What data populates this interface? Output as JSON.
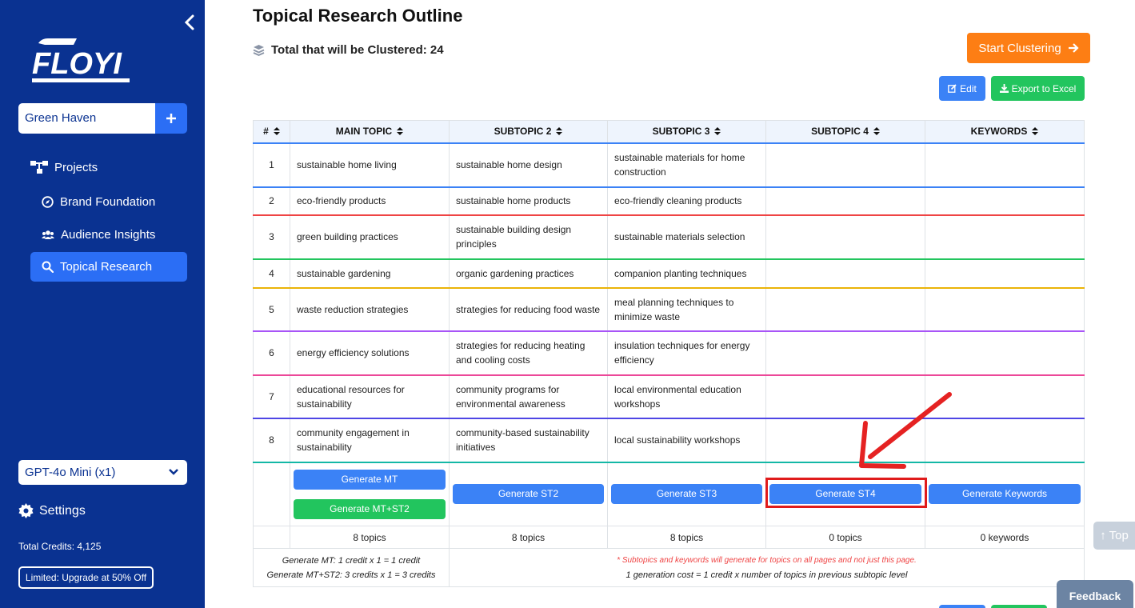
{
  "sidebar": {
    "project_name": "Green Haven",
    "logo_text": "FLOYI",
    "nav": {
      "projects": "Projects",
      "brand_foundation": "Brand Foundation",
      "audience_insights": "Audience Insights",
      "topical_research": "Topical Research"
    },
    "model": "GPT-4o Mini (x1)",
    "settings": "Settings",
    "credits": "Total Credits: 4,125",
    "upgrade": "Limited: Upgrade at 50% Off"
  },
  "header": {
    "title": "Topical Research Outline",
    "total": "Total that will be Clustered: 24",
    "start": "Start Clustering",
    "edit": "Edit",
    "export": "Export to Excel"
  },
  "table": {
    "columns": [
      "#",
      "MAIN TOPIC",
      "SUBTOPIC 2",
      "SUBTOPIC 3",
      "SUBTOPIC 4",
      "KEYWORDS"
    ],
    "rows": [
      {
        "n": "1",
        "mt": "sustainable home living",
        "st2": "sustainable home design",
        "st3": "sustainable materials for home construction",
        "st4": "",
        "kw": "",
        "color": "#3b82f6"
      },
      {
        "n": "2",
        "mt": "eco-friendly products",
        "st2": "sustainable home products",
        "st3": "eco-friendly cleaning products",
        "st4": "",
        "kw": "",
        "color": "#ef4444"
      },
      {
        "n": "3",
        "mt": "green building practices",
        "st2": "sustainable building design principles",
        "st3": "sustainable materials selection",
        "st4": "",
        "kw": "",
        "color": "#22c55e"
      },
      {
        "n": "4",
        "mt": "sustainable gardening",
        "st2": "organic gardening practices",
        "st3": "companion planting techniques",
        "st4": "",
        "kw": "",
        "color": "#eab308"
      },
      {
        "n": "5",
        "mt": "waste reduction strategies",
        "st2": "strategies for reducing food waste",
        "st3": "meal planning techniques to minimize waste",
        "st4": "",
        "kw": "",
        "color": "#a855f7"
      },
      {
        "n": "6",
        "mt": "energy efficiency solutions",
        "st2": "strategies for reducing heating and cooling costs",
        "st3": "insulation techniques for energy efficiency",
        "st4": "",
        "kw": "",
        "color": "#ec4899"
      },
      {
        "n": "7",
        "mt": "educational resources for sustainability",
        "st2": "community programs for environmental awareness",
        "st3": "local environmental education workshops",
        "st4": "",
        "kw": "",
        "color": "#4f46e5"
      },
      {
        "n": "8",
        "mt": "community engagement in sustainability",
        "st2": "community-based sustainability initiatives",
        "st3": "local sustainability workshops",
        "st4": "",
        "kw": "",
        "color": "#14b8a6"
      }
    ],
    "buttons": {
      "gen_mt": "Generate MT",
      "gen_mt_st2": "Generate MT+ST2",
      "gen_st2": "Generate ST2",
      "gen_st3": "Generate ST3",
      "gen_st4": "Generate ST4",
      "gen_kw": "Generate Keywords"
    },
    "counts": {
      "mt": "8 topics",
      "st2": "8 topics",
      "st3": "8 topics",
      "st4": "0 topics",
      "kw": "0 keywords"
    },
    "footer": {
      "cost_mt": "Generate MT: 1 credit x 1 = 1 credit",
      "cost_mt_st2": "Generate MT+ST2: 3 credits x 1 = 3 credits",
      "note": "* Subtopics and keywords will generate for topics on all pages and not just this page.",
      "cost_rule": "1 generation cost = 1 credit x number of topics in previous subtopic level"
    }
  },
  "floating": {
    "top": "↑ Top",
    "feedback": "Feedback"
  },
  "colors": {
    "sidebar": "#0a3291",
    "accent_blue": "#3b82f6",
    "accent_green": "#22c55e",
    "accent_orange": "#fd7e14",
    "highlight_red": "#e01b1b"
  }
}
